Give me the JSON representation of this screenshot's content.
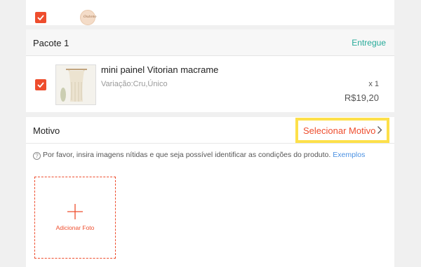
{
  "shop": {
    "logo_icon": "shop-logo-icon",
    "logo_text": "Outono"
  },
  "package": {
    "title": "Pacote 1",
    "status": "Entregue",
    "status_color": "#26aa99"
  },
  "product": {
    "name": "mini painel Vitorian macrame",
    "variation": "Variação:Cru,Único",
    "quantity": "x 1",
    "price": "R$19,20",
    "thumbnail_icon": "macrame-thumbnail"
  },
  "motivo": {
    "label": "Motivo",
    "select_label": "Selecionar Motivo",
    "select_icon": "chevron-right-icon",
    "highlight_color": "#fde04a"
  },
  "hint": {
    "text": "Por favor, insira imagens nítidas e que seja possível identificar as condições do produto.",
    "link": "Exemplos"
  },
  "upload": {
    "label": "Adicionar Foto",
    "icon": "plus-icon"
  },
  "colors": {
    "accent": "#ee4d2d",
    "link": "#4a90e2"
  }
}
